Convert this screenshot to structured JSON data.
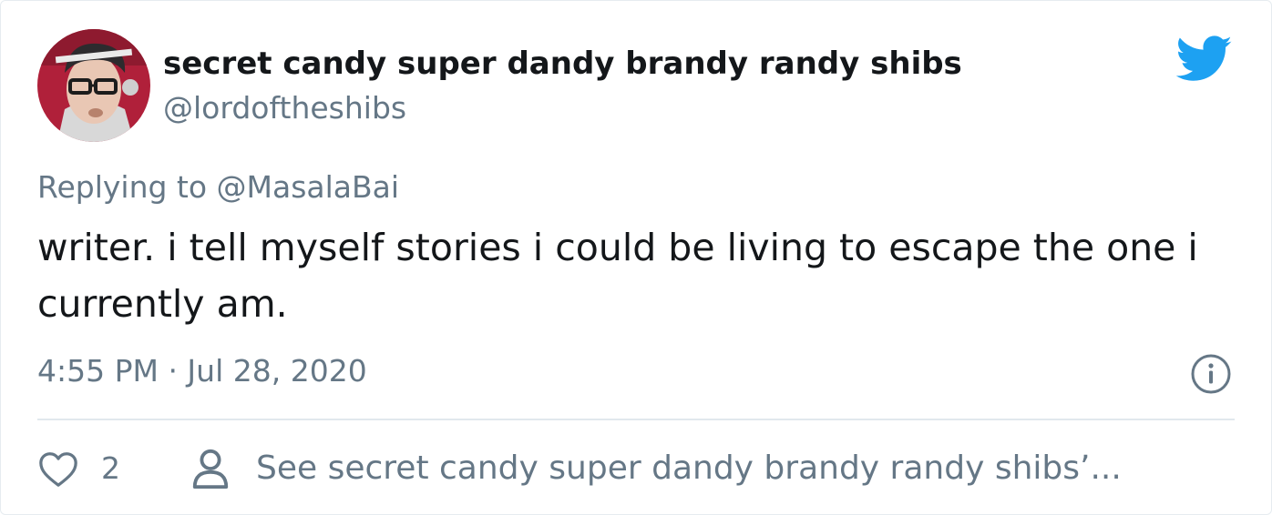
{
  "tweet": {
    "author": {
      "display_name": "secret candy super dandy brandy randy shibs",
      "handle": "@lordoftheshibs",
      "avatar": "profile-photo"
    },
    "replying_to": "Replying to @MasalaBai",
    "text": "writer. i tell myself stories i could be living to escape the one i currently am.",
    "timestamp": "4:55 PM · Jul 28, 2020",
    "likes": "2",
    "see_more": "See secret candy super dandy brandy randy shibs’..."
  },
  "icons": {
    "brand": "twitter-bird-icon",
    "info": "info-icon",
    "like": "heart-icon",
    "profile": "person-icon"
  },
  "colors": {
    "brand": "#1da1f2",
    "text_primary": "#14171a",
    "text_secondary": "#657786",
    "divider": "#e1e8ed"
  }
}
